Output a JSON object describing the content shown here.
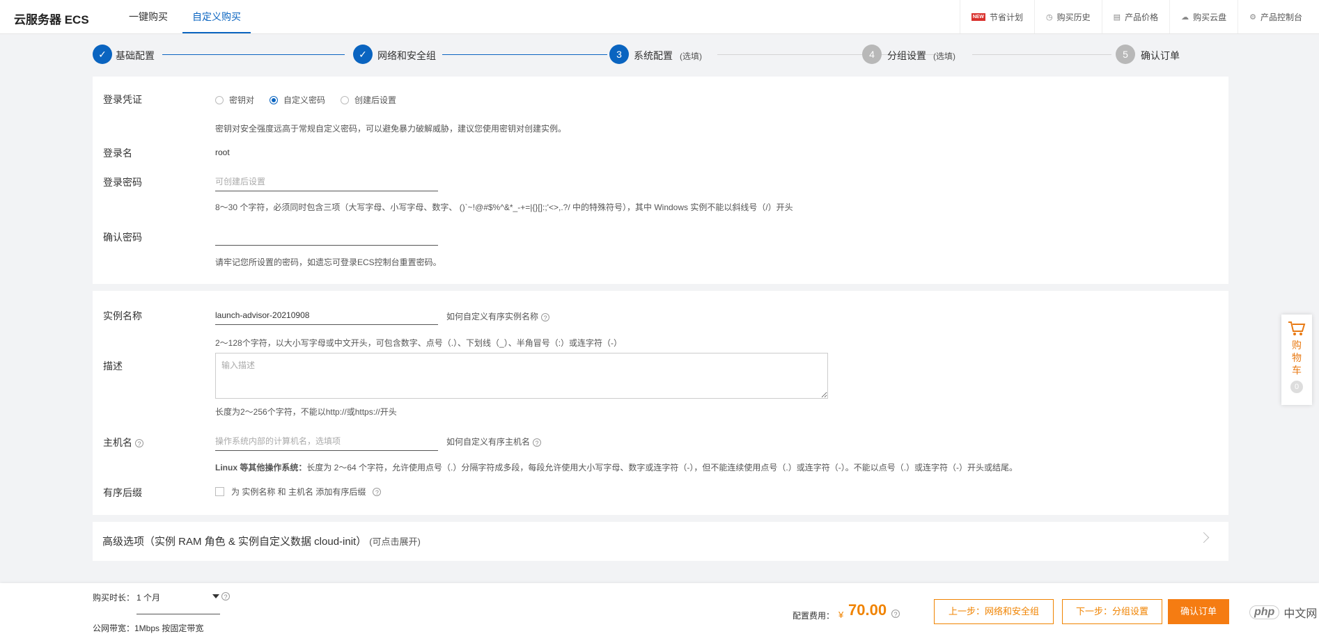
{
  "header": {
    "brand": "云服务器 ECS",
    "tabs": [
      {
        "label": "一键购买"
      },
      {
        "label": "自定义购买"
      }
    ],
    "links": [
      {
        "label": "节省计划",
        "badge": "NEW"
      },
      {
        "label": "购买历史",
        "icon": "clock-icon"
      },
      {
        "label": "产品价格",
        "icon": "document-icon"
      },
      {
        "label": "购买云盘",
        "icon": "cloud-icon"
      },
      {
        "label": "产品控制台",
        "icon": "gear-icon"
      }
    ]
  },
  "steps": [
    {
      "label": "基础配置",
      "state": "done",
      "num": "1"
    },
    {
      "label": "网络和安全组",
      "state": "done",
      "num": "2"
    },
    {
      "label": "系统配置",
      "state": "current",
      "num": "3",
      "optional": "(选填)"
    },
    {
      "label": "分组设置",
      "state": "todo",
      "num": "4",
      "optional": "(选填)"
    },
    {
      "label": "确认订单",
      "state": "todo",
      "num": "5"
    }
  ],
  "login": {
    "credential_label": "登录凭证",
    "options": [
      "密钥对",
      "自定义密码",
      "创建后设置"
    ],
    "selected": "自定义密码",
    "credential_hint": "密钥对安全强度远高于常规自定义密码，可以避免暴力破解威胁，建议您使用密钥对创建实例。",
    "username_label": "登录名",
    "username_value": "root",
    "password_label": "登录密码",
    "password_placeholder": "可创建后设置",
    "password_hint": "8～30 个字符，必须同时包含三项（大写字母、小写字母、数字、 ()`~!@#$%^&*_-+=|{}[]:;'<>,.?/ 中的特殊符号），其中 Windows 实例不能以斜线号（/）开头",
    "confirm_label": "确认密码",
    "confirm_value": "",
    "confirm_hint": "请牢记您所设置的密码，如遗忘可登录ECS控制台重置密码。"
  },
  "instance": {
    "name_label": "实例名称",
    "name_value": "launch-advisor-20210908",
    "name_help": "如何自定义有序实例名称",
    "name_hint": "2～128个字符，以大小写字母或中文开头，可包含数字、点号（.）、下划线（_）、半角冒号（:）或连字符（-）",
    "desc_label": "描述",
    "desc_placeholder": "输入描述",
    "desc_hint": "长度为2～256个字符，不能以http://或https://开头",
    "host_label": "主机名",
    "host_placeholder": "操作系统内部的计算机名，选填项",
    "host_help": "如何自定义有序主机名",
    "host_hint_bold": "Linux 等其他操作系统：",
    "host_hint": "长度为 2～64 个字符，允许使用点号（.）分隔字符成多段，每段允许使用大小写字母、数字或连字符（-），但不能连续使用点号（.）或连字符（-）。不能以点号（.）或连字符（-）开头或结尾。",
    "suffix_label": "有序后缀",
    "suffix_checkbox": "为 实例名称 和 主机名 添加有序后缀"
  },
  "advanced": {
    "title": "高级选项（实例 RAM 角色 & 实例自定义数据 cloud-init）",
    "hint": "(可点击展开)"
  },
  "cart": {
    "label": [
      "购",
      "物",
      "车"
    ],
    "count": "0"
  },
  "footer": {
    "duration_label": "购买时长：",
    "duration_value": "1 个月",
    "bandwidth_label": "公网带宽：",
    "bandwidth_value": "1Mbps 按固定带宽",
    "price_label": "配置费用：",
    "currency": "¥",
    "price": "70.00",
    "prev_btn": "上一步：网络和安全组",
    "next_btn": "下一步：分组设置",
    "confirm_btn": "确认订单"
  },
  "watermark": {
    "logo": "php",
    "text": "中文网"
  },
  "colors": {
    "primary": "#0a64c0",
    "accent": "#f08300",
    "page_bg": "#f2f3f5"
  }
}
